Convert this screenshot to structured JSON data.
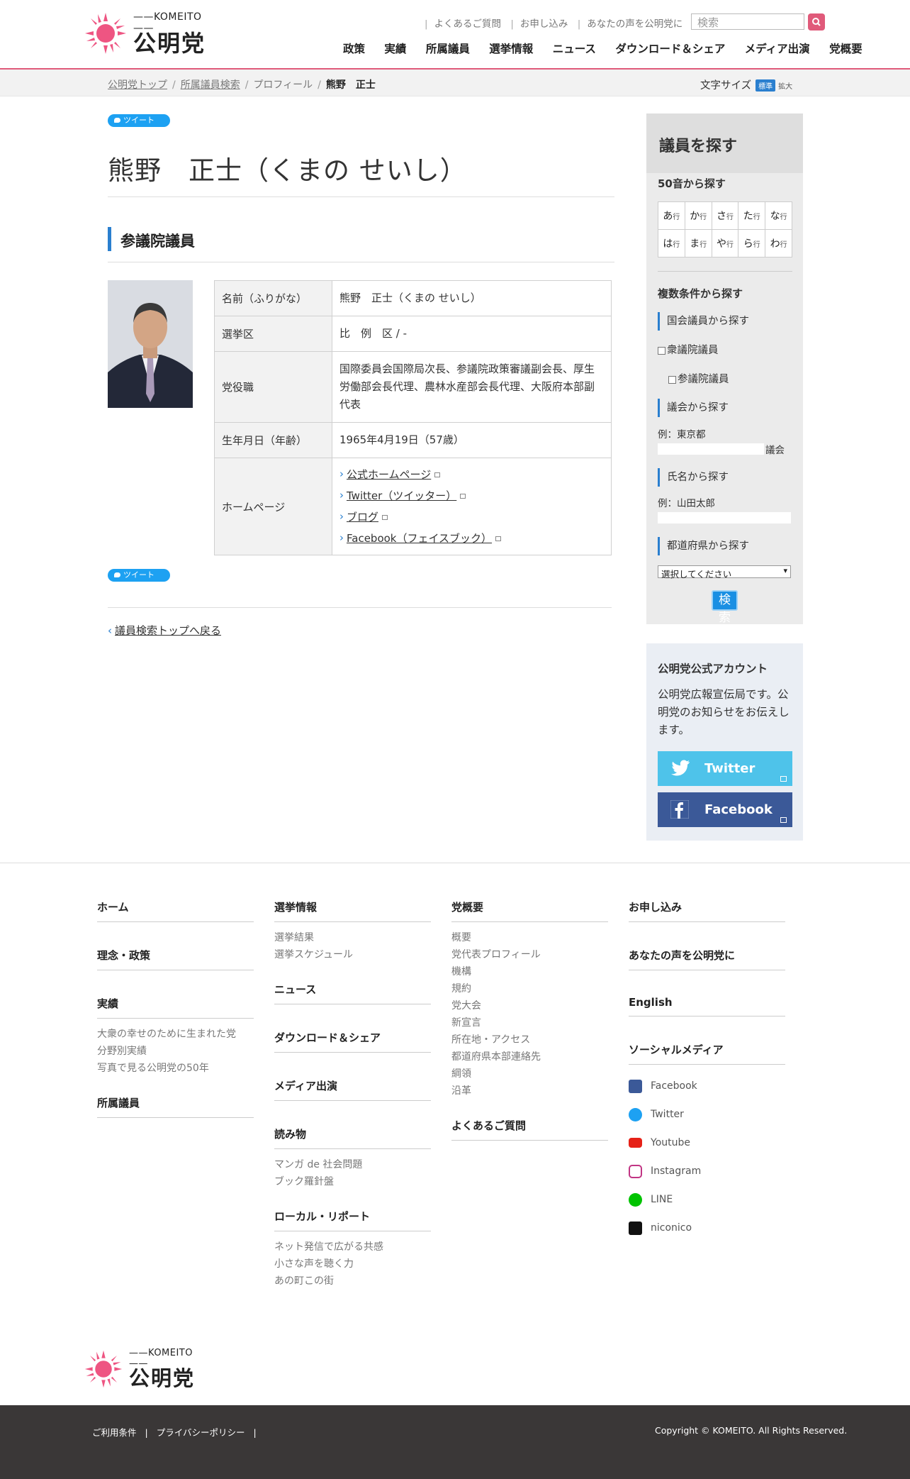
{
  "header": {
    "logo_en": "KOMEITO",
    "logo_jp": "公明党",
    "util_links": [
      "よくあるご質問",
      "お申し込み",
      "あなたの声を公明党に"
    ],
    "search_placeholder": "検索",
    "nav": [
      "政策",
      "実績",
      "所属議員",
      "選挙情報",
      "ニュース",
      "ダウンロード＆シェア",
      "メディア出演",
      "党概要"
    ]
  },
  "breadcrumb": {
    "items": [
      "公明党トップ",
      "所属議員検索",
      "プロフィール"
    ],
    "current": "熊野　正士",
    "font_size_label": "文字サイズ",
    "font_std": "標準",
    "font_big": "拡大"
  },
  "tweet_label": "ツイート",
  "profile": {
    "title": "熊野　正士（くまの せいし）",
    "section": "参議院議員",
    "rows": [
      {
        "key": "名前（ふりがな）",
        "value": "熊野　正士（くまの せいし）"
      },
      {
        "key": "選挙区",
        "value": "比　例　区 / -"
      },
      {
        "key": "党役職",
        "value": "国際委員会国際局次長、参議院政策審議副会長、厚生労働部会長代理、農林水産部会長代理、大阪府本部副代表"
      },
      {
        "key": "生年月日（年齢）",
        "value": "1965年4月19日（57歳）"
      },
      {
        "key": "ホームページ",
        "value": ""
      }
    ],
    "homepage_links": [
      "公式ホームページ",
      "Twitter（ツイッター）",
      "ブログ",
      "Facebook（フェイスブック）"
    ],
    "back_link": "議員検索トップへ戻る"
  },
  "sidebar": {
    "title": "議員を探す",
    "kana_title": "50音から探す",
    "kana": [
      [
        "あ",
        "か",
        "さ",
        "た",
        "な"
      ],
      [
        "は",
        "ま",
        "や",
        "ら",
        "わ"
      ]
    ],
    "kana_suffix": "行",
    "multi_title": "複数条件から探す",
    "national_title": "国会議員から探す",
    "chk_shugiin": "衆議院議員",
    "chk_sangiin": "参議院議員",
    "council_title": "議会から探す",
    "council_example": "例：東京都",
    "council_suffix": "議会",
    "name_title": "氏名から探す",
    "name_example": "例：山田太郎",
    "pref_title": "都道府県から探す",
    "pref_select": "選択してください",
    "search_button": "検索"
  },
  "account": {
    "title": "公明党公式アカウント",
    "text": "公明党広報宣伝局です。公明党のお知らせをお伝えします。",
    "twitter": "Twitter",
    "facebook": "Facebook",
    "twitter_color": "#4ec3ea",
    "facebook_color": "#3b5998"
  },
  "footer": {
    "col1": [
      {
        "title": "ホーム",
        "links": []
      },
      {
        "title": "理念・政策",
        "links": []
      },
      {
        "title": "実績",
        "links": [
          "大衆の幸せのために生まれた党",
          "分野別実績",
          "写真で見る公明党の50年"
        ]
      },
      {
        "title": "所属議員",
        "links": []
      }
    ],
    "col2": [
      {
        "title": "選挙情報",
        "links": [
          "選挙結果",
          "選挙スケジュール"
        ]
      },
      {
        "title": "ニュース",
        "links": []
      },
      {
        "title": "ダウンロード＆シェア",
        "links": []
      },
      {
        "title": "メディア出演",
        "links": []
      },
      {
        "title": "読み物",
        "links": [
          "マンガ de 社会問題",
          "ブック羅針盤"
        ]
      },
      {
        "title": "ローカル・リポート",
        "links": [
          "ネット発信で広がる共感",
          "小さな声を聴く力",
          "あの町この街"
        ]
      }
    ],
    "col3": [
      {
        "title": "党概要",
        "links": [
          "概要",
          "党代表プロフィール",
          "機構",
          "規約",
          "党大会",
          "新宣言",
          "所在地・アクセス",
          "都道府県本部連絡先",
          "綱領",
          "沿革"
        ]
      },
      {
        "title": "よくあるご質問",
        "links": []
      }
    ],
    "col4": [
      {
        "title": "お申し込み"
      },
      {
        "title": "あなたの声を公明党に"
      },
      {
        "title": "English"
      },
      {
        "title": "ソーシャルメディア"
      }
    ],
    "social": [
      "Facebook",
      "Twitter",
      "Youtube",
      "Instagram",
      "LINE",
      "niconico"
    ],
    "bottom_links": [
      "ご利用条件",
      "プライバシーポリシー"
    ],
    "copyright": "Copyright © KOMEITO. All Rights Reserved."
  }
}
